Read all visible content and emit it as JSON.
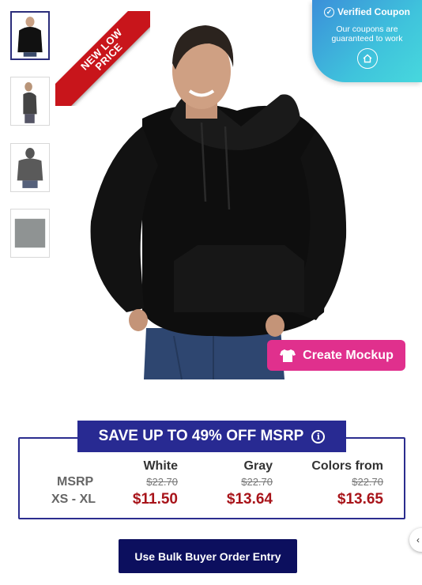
{
  "thumbnails": [
    {
      "label": "hoodie-front"
    },
    {
      "label": "hoodie-side"
    },
    {
      "label": "hoodie-back"
    },
    {
      "label": "fabric-swatch"
    }
  ],
  "ribbon": {
    "line1": "NEW LOW",
    "line2": "PRICE"
  },
  "coupon": {
    "title": "Verified Coupon",
    "subtitle": "Our coupons are guaranteed to work"
  },
  "mockup_button": {
    "label": "Create Mockup",
    "icon": "shirt-icon"
  },
  "savings": {
    "headline": "SAVE UP TO 49% OFF MSRP",
    "msrp_label": "MSRP",
    "size_range": "XS - XL",
    "columns": [
      {
        "name": "White",
        "msrp": "$22.70",
        "price": "$11.50"
      },
      {
        "name": "Gray",
        "msrp": "$22.70",
        "price": "$13.64"
      },
      {
        "name": "Colors from",
        "msrp": "$22.70",
        "price": "$13.65"
      }
    ]
  },
  "bulk_button": {
    "label": "Use Bulk Buyer Order Entry"
  },
  "colors": {
    "navy": "#282a92",
    "price_red": "#a8141a",
    "mockup_pink": "#e0308d",
    "ribbon_red": "#c8151b"
  }
}
